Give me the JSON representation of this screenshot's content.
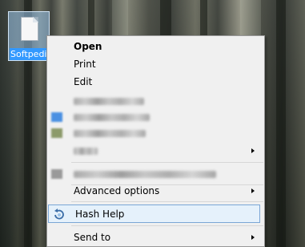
{
  "desktop": {
    "icon_label": "Softpedia",
    "icon_name": "document-icon"
  },
  "context_menu": {
    "items": {
      "open": "Open",
      "print": "Print",
      "edit": "Edit",
      "advanced_options": "Advanced options",
      "hash_help": "Hash Help",
      "send_to": "Send to"
    },
    "colors": {
      "background": "#f0f0f0",
      "border": "#979797",
      "highlight_bg": "#e5f1fb",
      "highlight_border": "#7aa6d6",
      "selection_blue": "#3399ff"
    }
  }
}
